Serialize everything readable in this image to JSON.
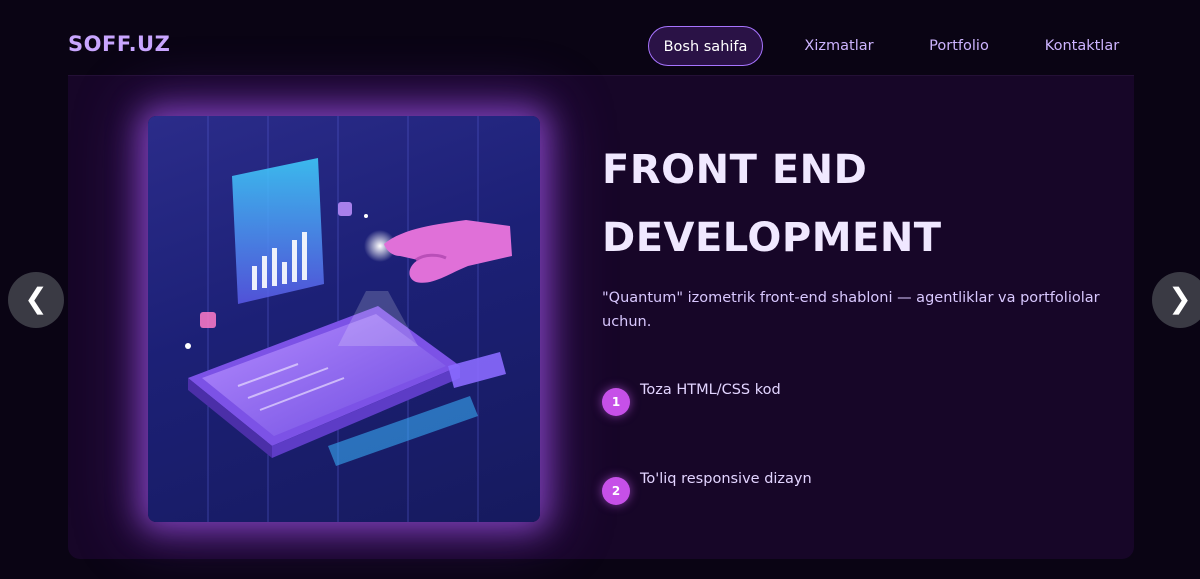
{
  "brand": {
    "logo": "SOFF.UZ"
  },
  "nav": {
    "items": [
      {
        "label": "Bosh sahifa"
      },
      {
        "label": "Xizmatlar"
      },
      {
        "label": "Portfolio"
      },
      {
        "label": "Kontaktlar"
      }
    ],
    "active_index": 0
  },
  "slide": {
    "title_line1": "FRONT END",
    "title_line2": "DEVELOPMENT",
    "description": "\"Quantum\" izometrik front-end shabloni — agentliklar va portfoliolar uchun.",
    "features": [
      {
        "number": "1",
        "text": "Toza HTML/CSS kod"
      },
      {
        "number": "2",
        "text": "To'liq responsive dizayn"
      }
    ],
    "illustration_icon": "isometric-tablet-illustration"
  },
  "controls": {
    "prev_icon": "❮",
    "next_icon": "❯"
  },
  "colors": {
    "background": "#0a0414",
    "card": "#170628",
    "accent": "#a774ff",
    "badge": "#c650e8",
    "logo": "#c9a6ff"
  }
}
